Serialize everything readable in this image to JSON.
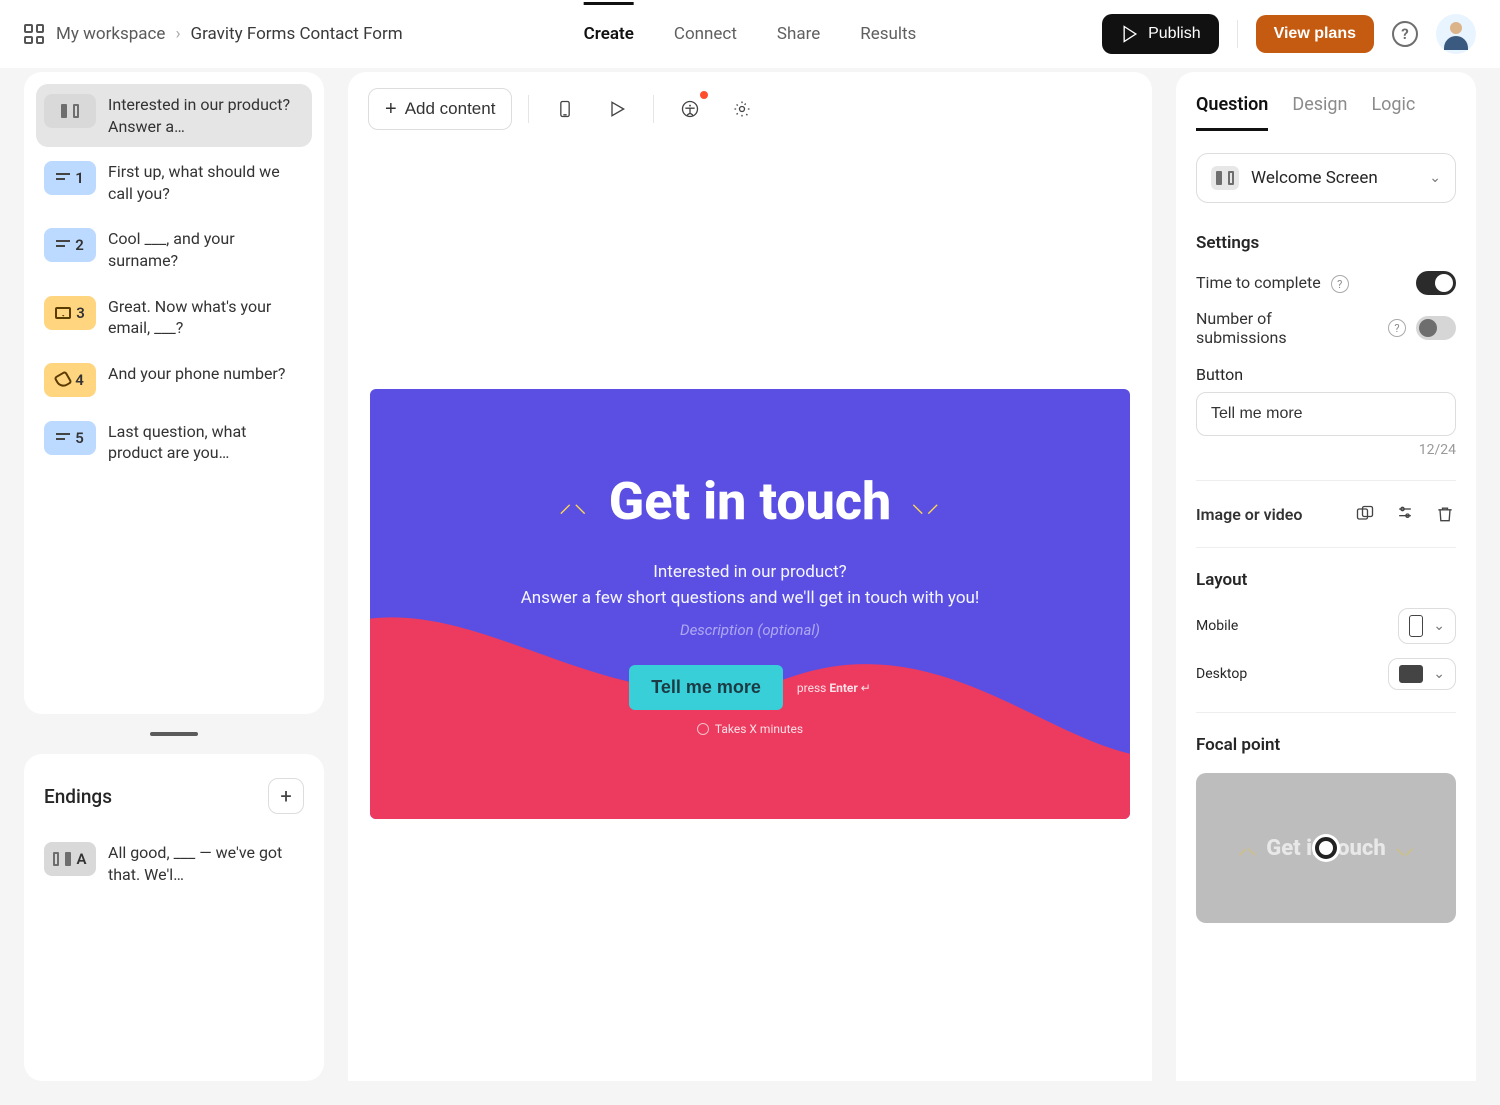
{
  "header": {
    "workspace": "My workspace",
    "form_title": "Gravity Forms Contact Form",
    "tabs": {
      "create": "Create",
      "connect": "Connect",
      "share": "Share",
      "results": "Results"
    },
    "publish": "Publish",
    "view_plans": "View plans"
  },
  "questions": [
    {
      "kind": "welcome",
      "tag_color": "grey",
      "num": "",
      "text": "Interested in our product? Answer a…"
    },
    {
      "kind": "short",
      "tag_color": "blue",
      "num": "1",
      "text": "First up, what should we call you?"
    },
    {
      "kind": "short",
      "tag_color": "blue",
      "num": "2",
      "text": "Cool ___, and your surname?"
    },
    {
      "kind": "email",
      "tag_color": "amber",
      "num": "3",
      "text": "Great. Now what's your email, ___?"
    },
    {
      "kind": "phone",
      "tag_color": "amber",
      "num": "4",
      "text": "And your phone number?"
    },
    {
      "kind": "short",
      "tag_color": "blue",
      "num": "5",
      "text": "Last question, what product are you…"
    }
  ],
  "endings": {
    "title": "Endings",
    "items": [
      {
        "tag": "A",
        "text": "All good, ___ — we've got that. We'l…"
      }
    ]
  },
  "toolbar": {
    "add_content": "Add content"
  },
  "preview": {
    "title": "Get in touch",
    "subtitle_1": "Interested in our product?",
    "subtitle_2": "Answer a few short questions and we'll get in touch with you!",
    "description_placeholder": "Description (optional)",
    "cta": "Tell me more",
    "hint_prefix": "press ",
    "hint_key": "Enter",
    "hint_symbol": " ↵",
    "time_text": "Takes X minutes"
  },
  "right": {
    "tabs": {
      "question": "Question",
      "design": "Design",
      "logic": "Logic"
    },
    "screen_type": "Welcome Screen",
    "settings_title": "Settings",
    "time_to_complete": "Time to complete",
    "number_of_submissions": "Number of submissions",
    "button_label": "Button",
    "button_text": "Tell me more",
    "button_counter": "12/24",
    "image_or_video": "Image or video",
    "layout_title": "Layout",
    "mobile": "Mobile",
    "desktop": "Desktop",
    "focal_title": "Focal point",
    "focal_text": "Get in touch"
  }
}
